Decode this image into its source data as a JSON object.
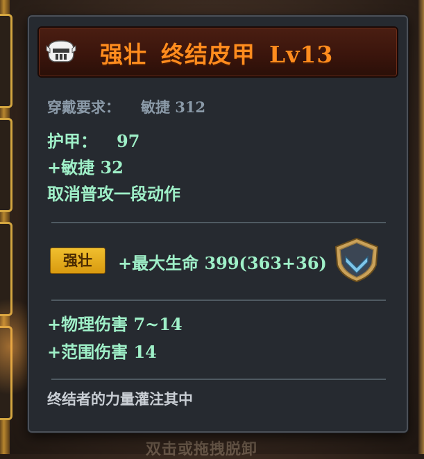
{
  "tooltip": {
    "title": {
      "prefix": "强壮",
      "name": "终结皮甲",
      "level": "Lv13"
    },
    "requirement": {
      "label": "穿戴要求：",
      "value": "敏捷  312"
    },
    "stats": {
      "armor_label": "护甲：",
      "armor_value": "97",
      "agility": "+敏捷  32",
      "effect": "取消普攻一段动作"
    },
    "enchant": {
      "badge": "强壮",
      "text": "+最大生命  399(363+36)"
    },
    "extra_stats": {
      "physical_damage": "+物理伤害  7~14",
      "area_damage": "+范围伤害  14"
    },
    "flavor_text": "终结者的力量灌注其中"
  },
  "background": {
    "bottom_hint": "双击或拖拽脱卸"
  },
  "colors": {
    "title": "#ff8c1e",
    "stat_green": "#9ff0c8",
    "requirement_gray": "#8b9aa8",
    "badge_gold": "#e6ad1e",
    "panel_bg": "#262a30"
  },
  "icons": [
    "helmet-icon",
    "armor-shield-icon"
  ]
}
